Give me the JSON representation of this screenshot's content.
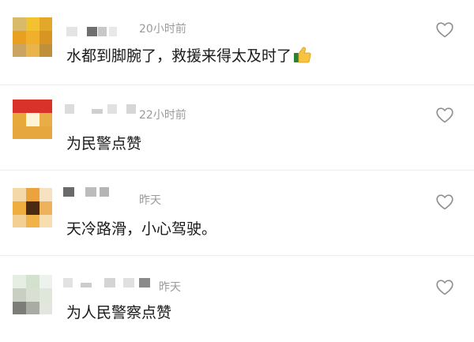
{
  "comments": [
    {
      "time": "20小时前",
      "text": "水都到脚腕了，救援来得太及时了",
      "emoji": "thumbs-up"
    },
    {
      "time": "22小时前",
      "text": "为民警点赞"
    },
    {
      "time": "昨天",
      "text": "天冷路滑，小心驾驶。"
    },
    {
      "time": "昨天",
      "text": "为人民警察点赞"
    }
  ],
  "icons": {
    "like": "heart-outline-icon"
  },
  "colors": {
    "time": "#9a9a9a",
    "text": "#1a1a1a",
    "heart": "#9a9a9a"
  }
}
